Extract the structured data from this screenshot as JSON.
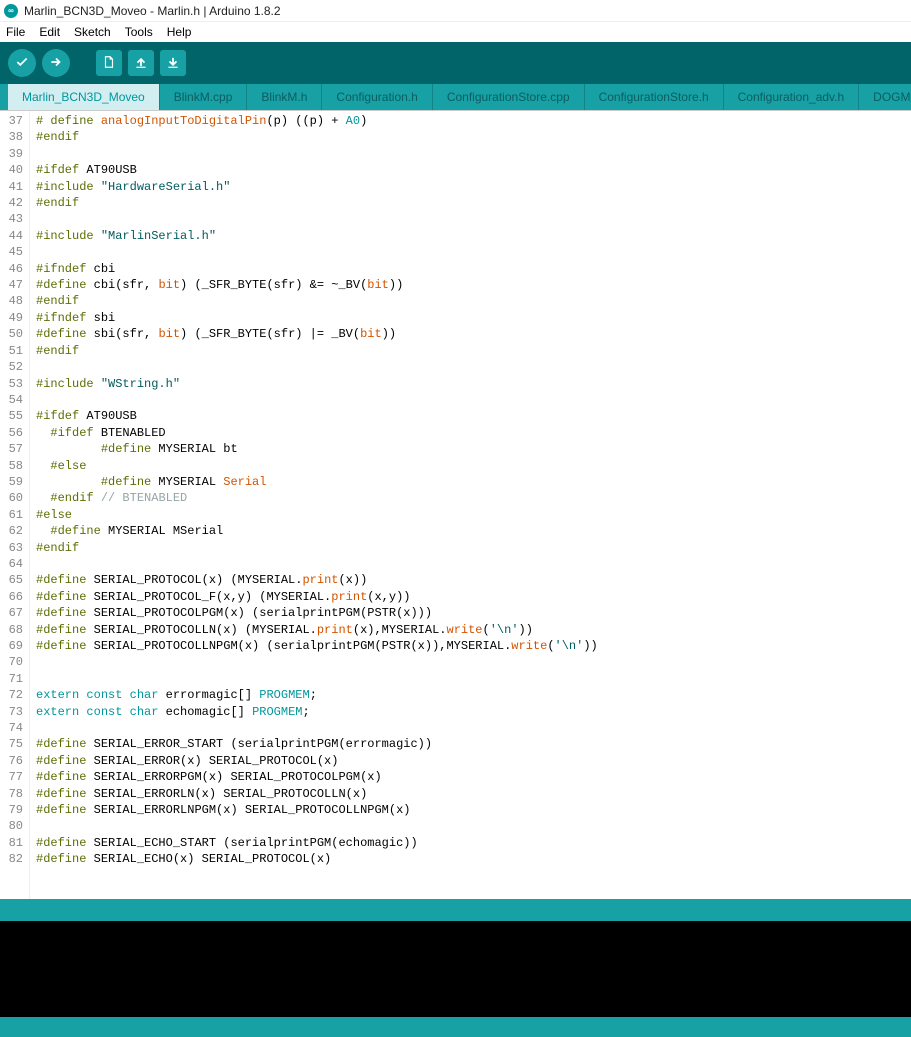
{
  "window": {
    "title": "Marlin_BCN3D_Moveo - Marlin.h | Arduino 1.8.2"
  },
  "menu": {
    "file": "File",
    "edit": "Edit",
    "sketch": "Sketch",
    "tools": "Tools",
    "help": "Help"
  },
  "toolbar": {
    "verify": "verify",
    "upload": "upload",
    "new": "new",
    "open": "open",
    "save": "save"
  },
  "tabs": [
    "Marlin_BCN3D_Moveo",
    "BlinkM.cpp",
    "BlinkM.h",
    "Configuration.h",
    "ConfigurationStore.cpp",
    "ConfigurationStore.h",
    "Configuration_adv.h",
    "DOGMbit"
  ],
  "code": {
    "first_line": 37,
    "lines": [
      [
        [
          "pre",
          "# define"
        ],
        [
          "txt",
          " "
        ],
        [
          "kw2",
          "analogInputToDigitalPin"
        ],
        [
          "txt",
          "(p) ((p) + "
        ],
        [
          "const",
          "A0"
        ],
        [
          "txt",
          ")"
        ]
      ],
      [
        [
          "pre",
          "#endif"
        ]
      ],
      [],
      [
        [
          "pre",
          "#ifdef"
        ],
        [
          "txt",
          " AT90USB"
        ]
      ],
      [
        [
          "pre",
          "#include"
        ],
        [
          "txt",
          " "
        ],
        [
          "str",
          "\"HardwareSerial.h\""
        ]
      ],
      [
        [
          "pre",
          "#endif"
        ]
      ],
      [],
      [
        [
          "pre",
          "#include"
        ],
        [
          "txt",
          " "
        ],
        [
          "str",
          "\"MarlinSerial.h\""
        ]
      ],
      [],
      [
        [
          "pre",
          "#ifndef"
        ],
        [
          "txt",
          " cbi"
        ]
      ],
      [
        [
          "pre",
          "#define"
        ],
        [
          "txt",
          " cbi(sfr, "
        ],
        [
          "kw2",
          "bit"
        ],
        [
          "txt",
          ") (_SFR_BYTE(sfr) &= ~_BV("
        ],
        [
          "kw2",
          "bit"
        ],
        [
          "txt",
          "))"
        ]
      ],
      [
        [
          "pre",
          "#endif"
        ]
      ],
      [
        [
          "pre",
          "#ifndef"
        ],
        [
          "txt",
          " sbi"
        ]
      ],
      [
        [
          "pre",
          "#define"
        ],
        [
          "txt",
          " sbi(sfr, "
        ],
        [
          "kw2",
          "bit"
        ],
        [
          "txt",
          ") (_SFR_BYTE(sfr) |= _BV("
        ],
        [
          "kw2",
          "bit"
        ],
        [
          "txt",
          "))"
        ]
      ],
      [
        [
          "pre",
          "#endif"
        ]
      ],
      [],
      [
        [
          "pre",
          "#include"
        ],
        [
          "txt",
          " "
        ],
        [
          "str",
          "\"WString.h\""
        ]
      ],
      [],
      [
        [
          "pre",
          "#ifdef"
        ],
        [
          "txt",
          " AT90USB"
        ]
      ],
      [
        [
          "txt",
          "  "
        ],
        [
          "pre",
          "#ifdef"
        ],
        [
          "txt",
          " BTENABLED"
        ]
      ],
      [
        [
          "txt",
          "         "
        ],
        [
          "pre",
          "#define"
        ],
        [
          "txt",
          " MYSERIAL bt"
        ]
      ],
      [
        [
          "txt",
          "  "
        ],
        [
          "pre",
          "#else"
        ]
      ],
      [
        [
          "txt",
          "         "
        ],
        [
          "pre",
          "#define"
        ],
        [
          "txt",
          " MYSERIAL "
        ],
        [
          "kw2",
          "Serial"
        ]
      ],
      [
        [
          "txt",
          "  "
        ],
        [
          "pre",
          "#endif"
        ],
        [
          "txt",
          " "
        ],
        [
          "cmt",
          "// BTENABLED"
        ]
      ],
      [
        [
          "pre",
          "#else"
        ]
      ],
      [
        [
          "txt",
          "  "
        ],
        [
          "pre",
          "#define"
        ],
        [
          "txt",
          " MYSERIAL MSerial"
        ]
      ],
      [
        [
          "pre",
          "#endif"
        ]
      ],
      [],
      [
        [
          "pre",
          "#define"
        ],
        [
          "txt",
          " SERIAL_PROTOCOL(x) (MYSERIAL."
        ],
        [
          "kw2",
          "print"
        ],
        [
          "txt",
          "(x))"
        ]
      ],
      [
        [
          "pre",
          "#define"
        ],
        [
          "txt",
          " SERIAL_PROTOCOL_F(x,y) (MYSERIAL."
        ],
        [
          "kw2",
          "print"
        ],
        [
          "txt",
          "(x,y))"
        ]
      ],
      [
        [
          "pre",
          "#define"
        ],
        [
          "txt",
          " SERIAL_PROTOCOLPGM(x) (serialprintPGM(PSTR(x)))"
        ]
      ],
      [
        [
          "pre",
          "#define"
        ],
        [
          "txt",
          " SERIAL_PROTOCOLLN(x) (MYSERIAL."
        ],
        [
          "kw2",
          "print"
        ],
        [
          "txt",
          "(x),MYSERIAL."
        ],
        [
          "kw2",
          "write"
        ],
        [
          "txt",
          "("
        ],
        [
          "str",
          "'\\n'"
        ],
        [
          "txt",
          "))"
        ]
      ],
      [
        [
          "pre",
          "#define"
        ],
        [
          "txt",
          " SERIAL_PROTOCOLLNPGM(x) (serialprintPGM(PSTR(x)),MYSERIAL."
        ],
        [
          "kw2",
          "write"
        ],
        [
          "txt",
          "("
        ],
        [
          "str",
          "'\\n'"
        ],
        [
          "txt",
          "))"
        ]
      ],
      [],
      [],
      [
        [
          "kw",
          "extern"
        ],
        [
          "txt",
          " "
        ],
        [
          "kw",
          "const"
        ],
        [
          "txt",
          " "
        ],
        [
          "kw",
          "char"
        ],
        [
          "txt",
          " errormagic[] "
        ],
        [
          "const",
          "PROGMEM"
        ],
        [
          "txt",
          ";"
        ]
      ],
      [
        [
          "kw",
          "extern"
        ],
        [
          "txt",
          " "
        ],
        [
          "kw",
          "const"
        ],
        [
          "txt",
          " "
        ],
        [
          "kw",
          "char"
        ],
        [
          "txt",
          " echomagic[] "
        ],
        [
          "const",
          "PROGMEM"
        ],
        [
          "txt",
          ";"
        ]
      ],
      [],
      [
        [
          "pre",
          "#define"
        ],
        [
          "txt",
          " SERIAL_ERROR_START (serialprintPGM(errormagic))"
        ]
      ],
      [
        [
          "pre",
          "#define"
        ],
        [
          "txt",
          " SERIAL_ERROR(x) SERIAL_PROTOCOL(x)"
        ]
      ],
      [
        [
          "pre",
          "#define"
        ],
        [
          "txt",
          " SERIAL_ERRORPGM(x) SERIAL_PROTOCOLPGM(x)"
        ]
      ],
      [
        [
          "pre",
          "#define"
        ],
        [
          "txt",
          " SERIAL_ERRORLN(x) SERIAL_PROTOCOLLN(x)"
        ]
      ],
      [
        [
          "pre",
          "#define"
        ],
        [
          "txt",
          " SERIAL_ERRORLNPGM(x) SERIAL_PROTOCOLLNPGM(x)"
        ]
      ],
      [],
      [
        [
          "pre",
          "#define"
        ],
        [
          "txt",
          " SERIAL_ECHO_START (serialprintPGM(echomagic))"
        ]
      ],
      [
        [
          "pre",
          "#define"
        ],
        [
          "txt",
          " SERIAL_ECHO(x) SERIAL_PROTOCOL(x)"
        ]
      ]
    ]
  }
}
